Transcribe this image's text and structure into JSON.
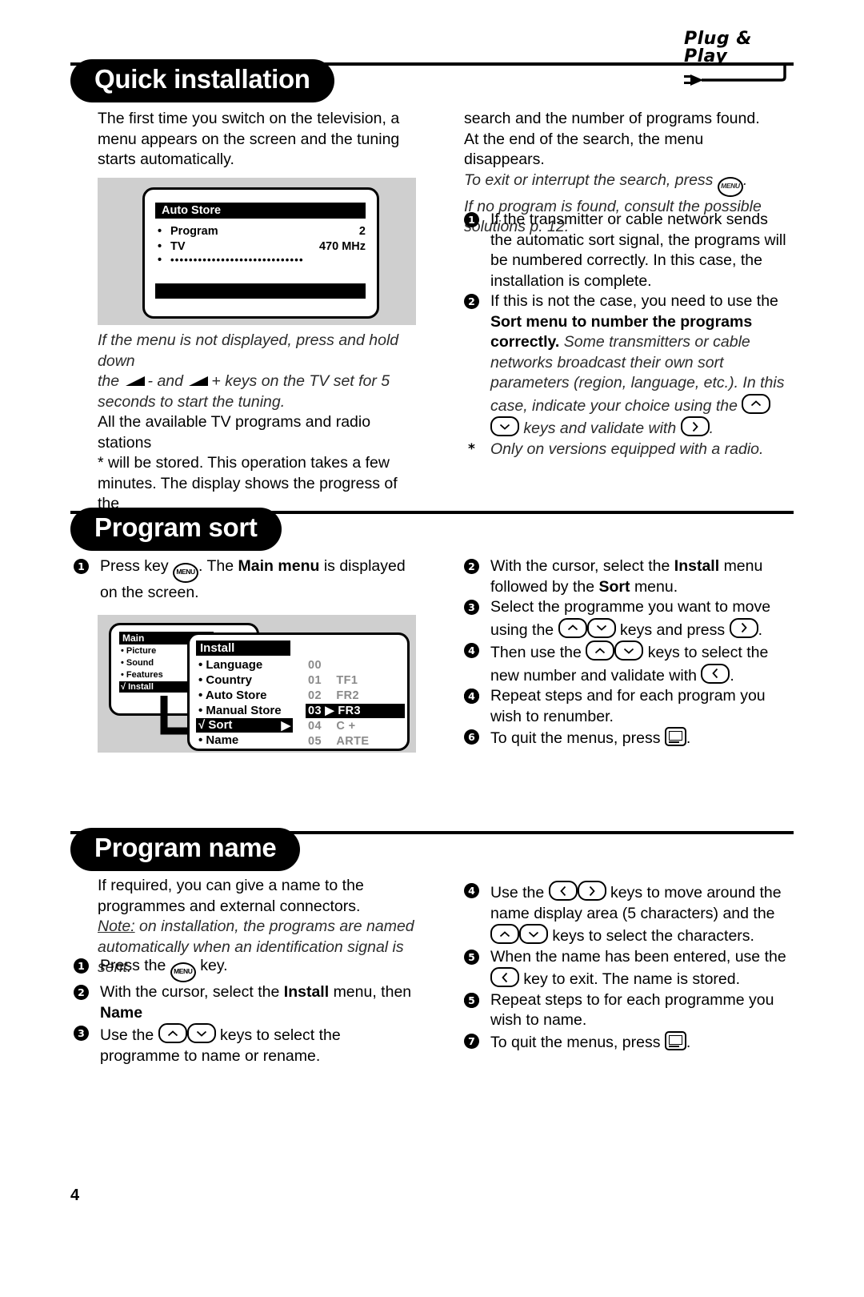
{
  "brand": {
    "logo_text": "Plug & Play",
    "logo_icon": "power-plug-icon"
  },
  "page_number": "4",
  "sections": {
    "quick": {
      "title": "Quick installation",
      "left": {
        "intro": "The first time you switch on the television, a menu appears on the screen and the tuning starts automatically.",
        "note_line1": "If the menu is not displayed, press and hold down",
        "note_the": "the",
        "note_minus": "- and",
        "note_plus": "+ keys on the TV set for 5",
        "note_line3": "seconds to start the tuning.",
        "body_line1": "All the available TV programs and radio stations",
        "body_star": "*",
        "body_line2": "will be stored. This operation takes a few",
        "body_line3": "minutes. The display shows the progress of the"
      },
      "right": {
        "cont_line1": "search and the number of programs found.",
        "cont_line2": "At the end of the search, the menu disappears.",
        "ital1_a": "To exit or interrupt the search, press",
        "ital1_b": ".",
        "ital2": "If no program is found, consult the possible solutions p. 12.",
        "item1": "If the transmitter or cable network sends the automatic sort signal, the programs will be numbered correctly. In this case, the installation is complete.",
        "item2_a": "If this is not the case, you need to use the",
        "item2_bold": "Sort",
        "item2_b": "menu to number the programs correctly.",
        "ital3_a": "Some transmitters or cable networks broadcast their own sort parameters (region, language, etc.). In this case, indicate your choice using the",
        "ital3_b": "keys and validate with",
        "ital3_c": ".",
        "footnote_star": "*",
        "footnote": "Only on versions equipped with a radio."
      },
      "screen": {
        "title": "Auto Store",
        "rows": [
          {
            "label": "Program",
            "value": "2"
          },
          {
            "label": "TV",
            "value": "470 MHz"
          }
        ],
        "progress_dots": "•••••••••••••••••••••••••••••"
      }
    },
    "sort": {
      "title": "Program sort",
      "left": {
        "item1_a": "Press key",
        "item1_b": ". The",
        "item1_bold": "Main menu",
        "item1_c": "is displayed on the screen."
      },
      "right": {
        "item2_a": "With the cursor, select the",
        "item2_bold1": "Install",
        "item2_b": "menu followed by the",
        "item2_bold2": "Sort",
        "item2_c": "menu.",
        "item3_a": "Select the programme you want to move using the",
        "item3_b": "keys and press",
        "item3_c": ".",
        "item4_a": "Then use the",
        "item4_b": "keys to select the new number and validate with",
        "item4_c": ".",
        "item5_a": "Repeat steps",
        "item5_b": "and",
        "item5_c": "for each program you wish to renumber.",
        "item6_a": "To quit the menus, press",
        "item6_b": "."
      },
      "screen": {
        "main_title": "Main",
        "main_items": [
          "• Picture",
          "• Sound",
          "• Features",
          "√ Install"
        ],
        "install_title": "Install",
        "install_items": [
          "• Language",
          "• Country",
          "• Auto Store",
          "• Manual Store",
          "√ Sort",
          "• Name"
        ],
        "programs": [
          {
            "num": "00",
            "name": ""
          },
          {
            "num": "01",
            "name": "TF1"
          },
          {
            "num": "02",
            "name": "FR2"
          },
          {
            "num": "03",
            "name": "FR3"
          },
          {
            "num": "04",
            "name": "C +"
          },
          {
            "num": "05",
            "name": "ARTE"
          }
        ],
        "selected_index": 3
      }
    },
    "name": {
      "title": "Program name",
      "left": {
        "intro": "If required, you can give a name to the programmes and external connectors.",
        "note_label": "Note:",
        "note_text": "on installation, the programs are named automatically when an identification signal is sent.",
        "item1_a": "Press the",
        "item1_b": "key.",
        "item2_a": "With the cursor, select the",
        "item2_bold1": "Install",
        "item2_b": "menu, then",
        "item2_bold2": "Name",
        "item3_a": "Use the",
        "item3_b": "keys to select the programme to name or rename."
      },
      "right": {
        "item4_a": "Use the",
        "item4_b": "keys to move around the name display area (5 characters) and the",
        "item4_c": "keys to select the characters.",
        "item5_a": "When the name has been entered, use the",
        "item5_b": "key to exit. The name is stored.",
        "item6_a": "Repeat steps",
        "item6_b": "to",
        "item6_c": "for each programme you wish to name.",
        "item7_a": "To quit the menus, press",
        "item7_b": "."
      }
    }
  },
  "icons": {
    "menu_key": "MENU",
    "up_key": "cursor-up-key",
    "down_key": "cursor-down-key",
    "left_key": "cursor-left-key",
    "right_key": "cursor-right-key",
    "exit_key": "exit-menu-key",
    "volume_key": "volume-key"
  },
  "colors": {
    "ink": "#000000",
    "shot_bg": "#cfcfcf",
    "grey_text": "#8a8a8a"
  }
}
